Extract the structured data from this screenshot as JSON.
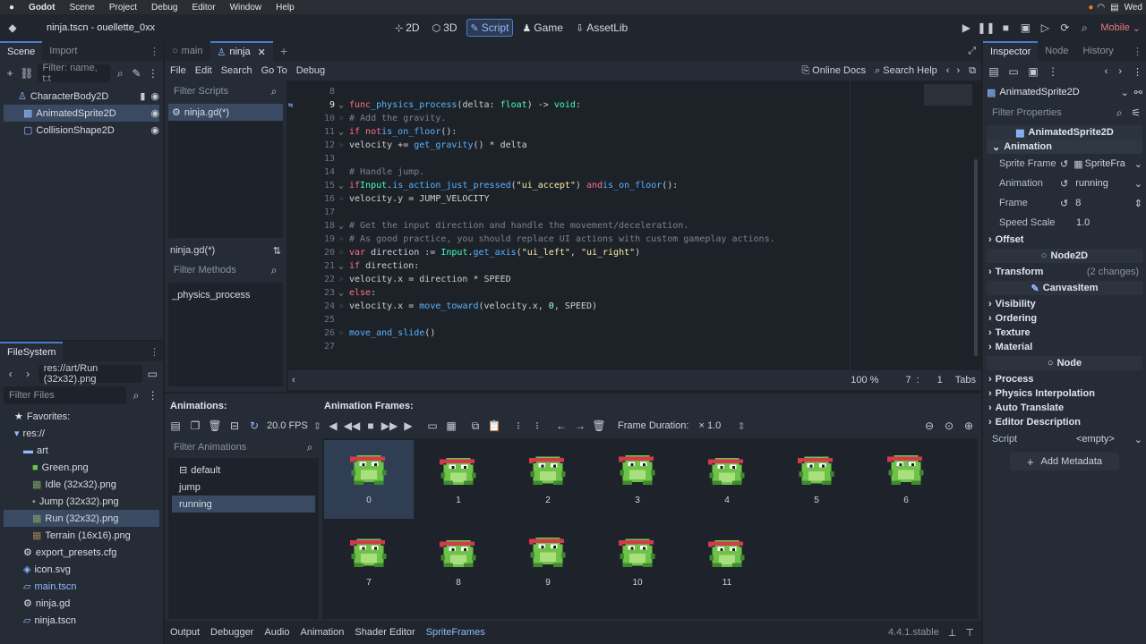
{
  "mac": {
    "menus": [
      "Godot",
      "Scene",
      "Project",
      "Debug",
      "Editor",
      "Window",
      "Help"
    ],
    "clock": "Wed"
  },
  "window_title": "ninja.tscn - ouellette_0xx",
  "workspaces": [
    {
      "label": "2D"
    },
    {
      "label": "3D"
    },
    {
      "label": "Script"
    },
    {
      "label": "Game"
    },
    {
      "label": "AssetLib"
    }
  ],
  "renderer": "Mobile",
  "scene": {
    "tabs": [
      "Scene",
      "Import"
    ],
    "filter_placeholder": "Filter: name, t:t",
    "nodes": [
      {
        "label": "CharacterBody2D"
      },
      {
        "label": "AnimatedSprite2D"
      },
      {
        "label": "CollisionShape2D"
      }
    ]
  },
  "filesystem": {
    "title": "FileSystem",
    "path": "res://art/Run (32x32).png",
    "filter_placeholder": "Filter Files",
    "items": [
      {
        "label": "Favorites:"
      },
      {
        "label": "res://"
      },
      {
        "label": "art"
      },
      {
        "label": "Green.png"
      },
      {
        "label": "Idle (32x32).png"
      },
      {
        "label": "Jump (32x32).png"
      },
      {
        "label": "Run (32x32).png"
      },
      {
        "label": "Terrain (16x16).png"
      },
      {
        "label": "export_presets.cfg"
      },
      {
        "label": "icon.svg"
      },
      {
        "label": "main.tscn"
      },
      {
        "label": "ninja.gd"
      },
      {
        "label": "ninja.tscn"
      }
    ]
  },
  "scene_tabs": [
    "main",
    "ninja"
  ],
  "script_menu": [
    "File",
    "Edit",
    "Search",
    "Go To",
    "Debug"
  ],
  "online_docs": "Online Docs",
  "search_help": "Search Help",
  "scripts": {
    "filter_placeholder": "Filter Scripts",
    "open": [
      "ninja.gd(*)"
    ],
    "current": "ninja.gd(*)",
    "methods_placeholder": "Filter Methods",
    "methods": [
      "_physics_process"
    ]
  },
  "code": {
    "line_numbers": [
      "8",
      "9",
      "10",
      "11",
      "12",
      "13",
      "14",
      "15",
      "16",
      "17",
      "18",
      "19",
      "20",
      "21",
      "22",
      "23",
      "24",
      "25",
      "26",
      "27"
    ],
    "zoom": "100 %",
    "cursor_line": "7",
    "cursor_col": "1",
    "indent": "Tabs"
  },
  "anim": {
    "animations_label": "Animations:",
    "frames_label": "Animation Frames:",
    "fps": "20.0 FPS",
    "filter_placeholder": "Filter Animations",
    "list": [
      "default",
      "jump",
      "running"
    ],
    "frame_duration_label": "Frame Duration:",
    "frame_duration": "× 1.0",
    "frames": [
      "0",
      "1",
      "2",
      "3",
      "4",
      "5",
      "6",
      "7",
      "8",
      "9",
      "10",
      "11"
    ]
  },
  "bottom_tabs": [
    "Output",
    "Debugger",
    "Audio",
    "Animation",
    "Shader Editor",
    "SpriteFrames"
  ],
  "version": "4.4.1.stable",
  "inspector": {
    "tabs": [
      "Inspector",
      "Node",
      "History"
    ],
    "object": "AnimatedSprite2D",
    "filter_placeholder": "Filter Properties",
    "class_header": "AnimatedSprite2D",
    "section": "Animation",
    "props": [
      {
        "label": "Sprite Frame",
        "value": "SpriteFra"
      },
      {
        "label": "Animation",
        "value": "running"
      },
      {
        "label": "Frame",
        "value": "8"
      },
      {
        "label": "Speed Scale",
        "value": "1.0"
      }
    ],
    "offset": "Offset",
    "node2d": "Node2D",
    "transform": "Transform",
    "transform_changes": "(2 changes)",
    "canvasitem": "CanvasItem",
    "canvas_sections": [
      "Visibility",
      "Ordering",
      "Texture",
      "Material"
    ],
    "node": "Node",
    "node_sections": [
      "Process",
      "Physics Interpolation",
      "Auto Translate",
      "Editor Description"
    ],
    "script_label": "Script",
    "script_value": "<empty>",
    "add_metadata": "Add Metadata"
  },
  "colors": {
    "accent": "#4a7bd1",
    "frog_green": "#6ec24a",
    "band_red": "#d23b4b"
  }
}
